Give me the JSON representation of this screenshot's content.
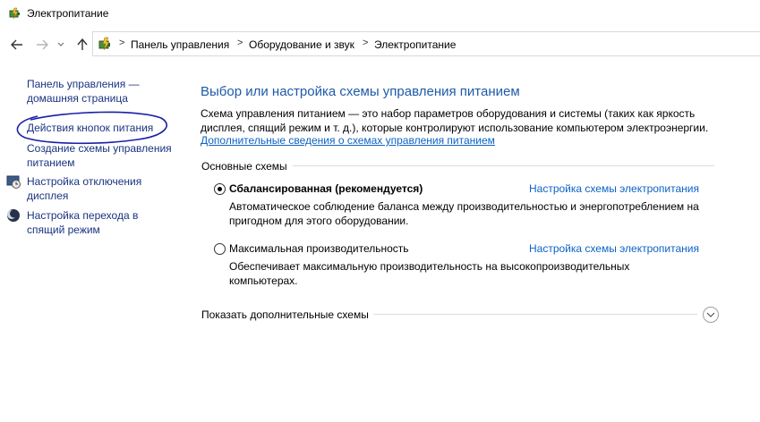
{
  "window": {
    "title": "Электропитание",
    "icon": "power-options-icon"
  },
  "navigation": {
    "back_icon": "arrow-left-icon",
    "forward_icon": "arrow-right-icon",
    "recent_icon": "chevron-down-icon",
    "up_icon": "arrow-up-icon"
  },
  "breadcrumb": {
    "icon": "control-panel-icon",
    "items": [
      "Панель управления",
      "Оборудование и звук",
      "Электропитание"
    ],
    "separator": ">"
  },
  "sidebar": {
    "home_link": "Панель управления —\nдомашняя страница",
    "items": [
      {
        "label": "Действия кнопок питания",
        "icon": ""
      },
      {
        "label": "Создание схемы управления\nпитанием",
        "icon": ""
      },
      {
        "label": "Настройка отключения\nдисплея",
        "icon": "display-timer-icon"
      },
      {
        "label": "Настройка перехода в\nспящий режим",
        "icon": "moon-icon"
      }
    ]
  },
  "main": {
    "title": "Выбор или настройка схемы управления питанием",
    "description": "Схема управления питанием — это набор параметров оборудования и системы (таких как яркость дисплея, спящий режим и т. д.), которые контролируют использование компьютером электроэнергии.",
    "more_info_link": "Дополнительные сведения о схемах управления питанием",
    "section_label": "Основные схемы",
    "plans": [
      {
        "name": "Сбалансированная (рекомендуется)",
        "selected": true,
        "link": "Настройка схемы электропитания",
        "description": "Автоматическое соблюдение баланса между производительностью и энергопотреблением на пригодном для этого оборудовании."
      },
      {
        "name": "Максимальная производительность",
        "selected": false,
        "link": "Настройка схемы электропитания",
        "description": "Обеспечивает максимальную производительность на высокопроизводительных компьютерах."
      }
    ],
    "show_more_label": "Показать дополнительные схемы",
    "expand_icon": "chevron-down-circle-icon"
  },
  "colors": {
    "link": "#0b63c4",
    "sidebar_link": "#1a3380",
    "title": "#1e5aa8",
    "annotation": "#1a1fa8"
  }
}
